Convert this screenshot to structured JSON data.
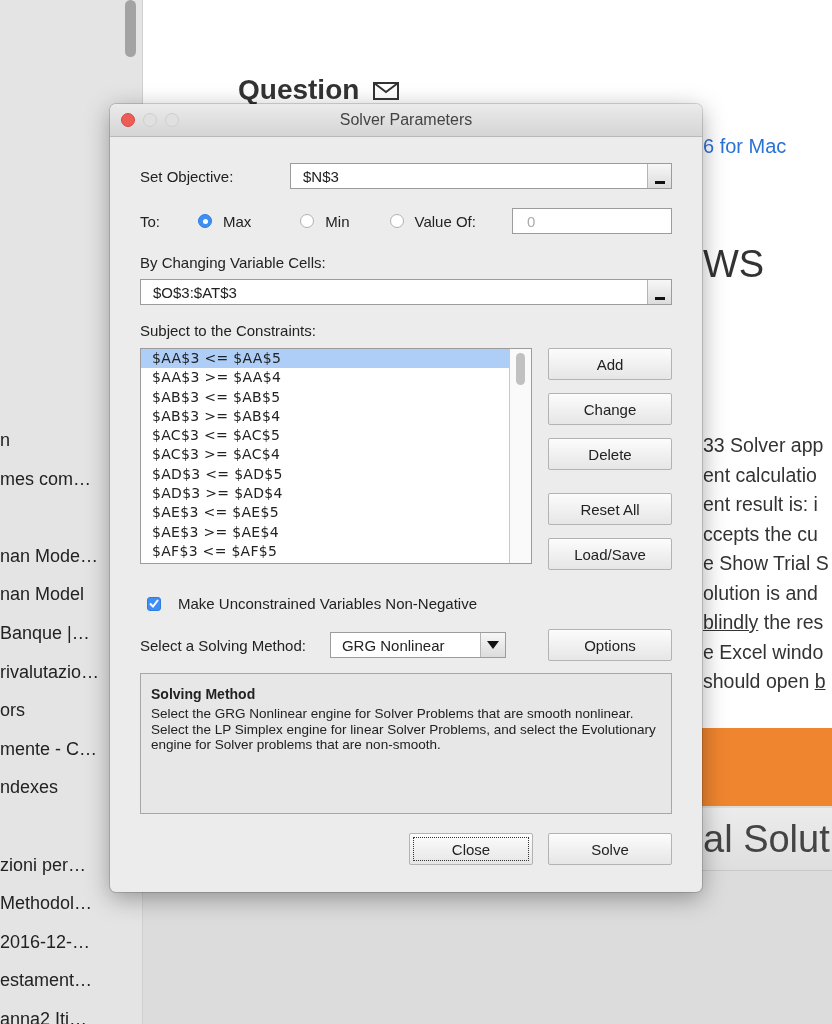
{
  "sidebar": {
    "items": [
      {
        "label": "n",
        "gap_before": false
      },
      {
        "label": "mes com…",
        "gap_before": false
      },
      {
        "label": "nan Mode…",
        "gap_before": true
      },
      {
        "label": "nan Model",
        "gap_before": false
      },
      {
        "label": "Banque |…",
        "gap_before": false
      },
      {
        "label": "rivalutazio…",
        "gap_before": false
      },
      {
        "label": "ors",
        "gap_before": false
      },
      {
        "label": "mente - C…",
        "gap_before": false
      },
      {
        "label": "ndexes",
        "gap_before": false
      },
      {
        "label": "zioni per…",
        "gap_before": true
      },
      {
        "label": "Methodol…",
        "gap_before": false
      },
      {
        "label": "2016-12-…",
        "gap_before": false
      },
      {
        "label": "estament…",
        "gap_before": false
      },
      {
        "label": "anna2 Iti…",
        "gap_before": false
      }
    ]
  },
  "page": {
    "heading": "Question",
    "link": "6 for Mac",
    "title": "WS",
    "paragraph": [
      [
        {
          "text": "33 Solver app",
          "underline": false
        }
      ],
      [
        {
          "text": "ent calculatio",
          "underline": false
        }
      ],
      [
        {
          "text": "ent result is: i",
          "underline": false
        }
      ],
      [
        {
          "text": "ccepts the cu",
          "underline": false
        }
      ],
      [
        {
          "text": "e Show Trial S",
          "underline": false
        }
      ],
      [
        {
          "text": "olution is and",
          "underline": false
        }
      ],
      [
        {
          "text": "blindly",
          "underline": true
        },
        {
          "text": " the res",
          "underline": false
        }
      ],
      [
        {
          "text": "e Excel windo",
          "underline": false
        }
      ],
      [
        {
          "text": "should open ",
          "underline": false
        },
        {
          "text": "b",
          "underline": true
        }
      ]
    ],
    "banner_text": "al Solut"
  },
  "dialog": {
    "title": "Solver Parameters",
    "window_controls": [
      {
        "kind": "close",
        "disabled": false
      },
      {
        "kind": "minimize",
        "disabled": true
      },
      {
        "kind": "zoom",
        "disabled": true
      }
    ],
    "objective": {
      "label": "Set Objective:",
      "value": "$N$3"
    },
    "to": {
      "label": "To:",
      "options": [
        {
          "label": "Max",
          "selected": true
        },
        {
          "label": "Min",
          "selected": false
        },
        {
          "label": "Value Of:",
          "selected": false
        }
      ],
      "value_field": {
        "value": "0",
        "disabled": true
      }
    },
    "variable_cells": {
      "label": "By Changing Variable Cells:",
      "value": "$O$3:$AT$3"
    },
    "constraints": {
      "label": "Subject to the Constraints:",
      "items": [
        {
          "text": "$AA$3 <= $AA$5",
          "selected": true
        },
        {
          "text": "$AA$3 >= $AA$4",
          "selected": false
        },
        {
          "text": "$AB$3 <= $AB$5",
          "selected": false
        },
        {
          "text": "$AB$3 >= $AB$4",
          "selected": false
        },
        {
          "text": "$AC$3 <= $AC$5",
          "selected": false
        },
        {
          "text": "$AC$3 >= $AC$4",
          "selected": false
        },
        {
          "text": "$AD$3 <= $AD$5",
          "selected": false
        },
        {
          "text": "$AD$3 >= $AD$4",
          "selected": false
        },
        {
          "text": "$AE$3 <= $AE$5",
          "selected": false
        },
        {
          "text": "$AE$3 >= $AE$4",
          "selected": false
        },
        {
          "text": "$AF$3 <= $AF$5",
          "selected": false
        }
      ]
    },
    "edit_buttons": [
      "Add",
      "Change",
      "Delete"
    ],
    "file_buttons": [
      "Reset All",
      "Load/Save"
    ],
    "nonnegative": {
      "label": "Make Unconstrained Variables Non-Negative",
      "checked": true
    },
    "method": {
      "label": "Select a Solving Method:",
      "value": "GRG Nonlinear",
      "button": "Options"
    },
    "method_info": {
      "title": "Solving Method",
      "text": "Select the GRG Nonlinear engine for Solver Problems that are smooth nonlinear. Select the LP Simplex engine for linear Solver Problems, and select the Evolutionary engine for Solver problems that are non-smooth."
    },
    "footer_buttons": [
      {
        "label": "Close",
        "focused": true
      },
      {
        "label": "Solve",
        "focused": false
      }
    ]
  }
}
